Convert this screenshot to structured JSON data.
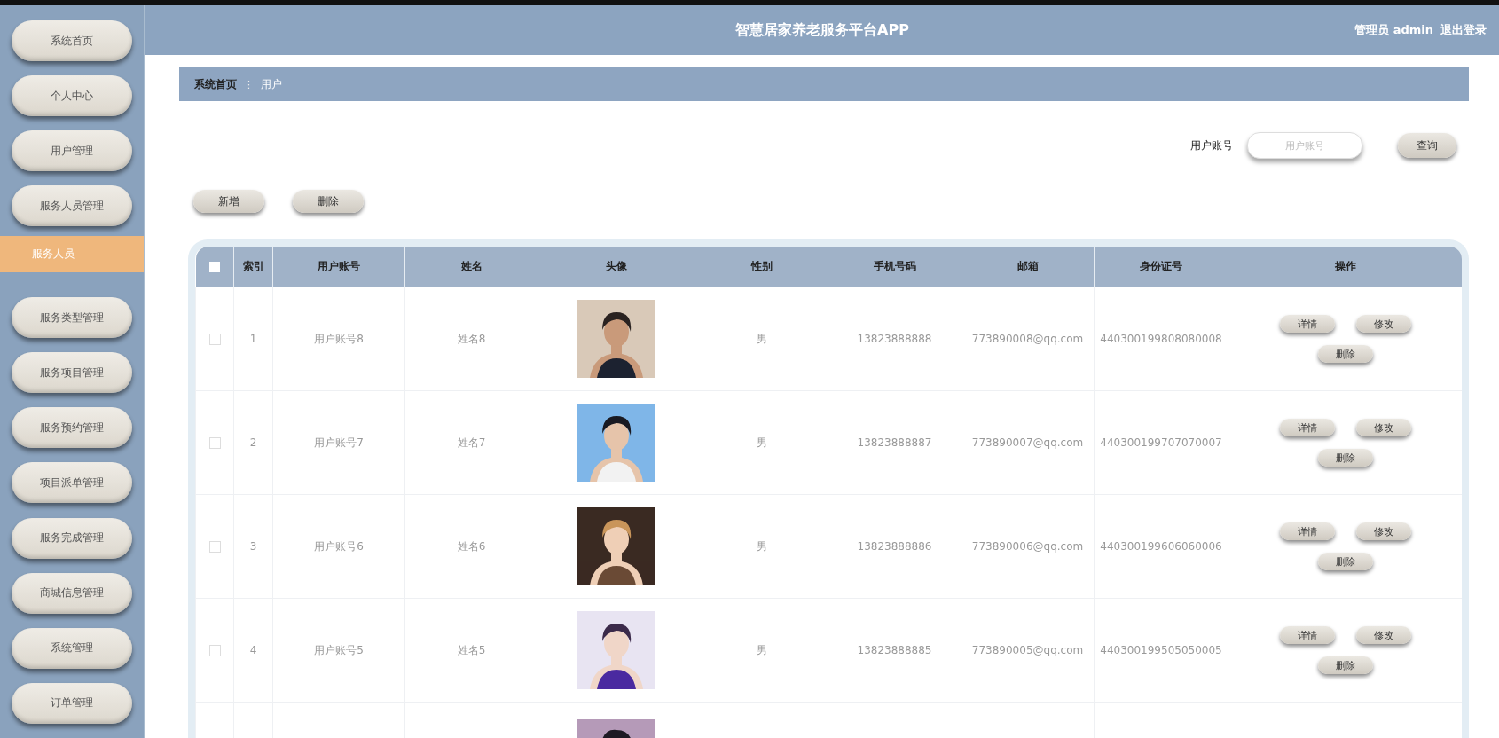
{
  "header": {
    "title": "智慧居家养老服务平台APP",
    "user": "管理员 admin",
    "logout": "退出登录"
  },
  "sidebar": {
    "items": [
      {
        "label": "系统首页",
        "selected": false
      },
      {
        "label": "个人中心",
        "selected": false
      },
      {
        "label": "用户管理",
        "selected": false
      },
      {
        "label": "服务人员管理",
        "selected": false,
        "expanded": true,
        "children": [
          {
            "label": "服务人员",
            "selected": true
          }
        ]
      },
      {
        "label": "服务类型管理",
        "selected": false
      },
      {
        "label": "服务项目管理",
        "selected": false
      },
      {
        "label": "服务预约管理",
        "selected": false
      },
      {
        "label": "项目派单管理",
        "selected": false
      },
      {
        "label": "服务完成管理",
        "selected": false
      },
      {
        "label": "商城信息管理",
        "selected": false
      },
      {
        "label": "系统管理",
        "selected": false
      },
      {
        "label": "订单管理",
        "selected": false
      }
    ]
  },
  "breadcrumb": {
    "items": [
      "系统首页",
      "用户"
    ],
    "separator": "⋮"
  },
  "search": {
    "label": "用户账号",
    "placeholder": "用户账号",
    "button": "查询"
  },
  "actions": [
    "新增",
    "删除"
  ],
  "table": {
    "select_all": {
      "checked": false
    },
    "columns": [
      "索引",
      "用户账号",
      "姓名",
      "头像",
      "性别",
      "手机号码",
      "邮箱",
      "身份证号",
      "操作"
    ],
    "rows": [
      {
        "checked": false,
        "cells": [
          "1",
          "用户账号8",
          "姓名8",
          {
            "kind": "picture"
          },
          "男",
          "13823888888",
          "773890008@qq.com",
          "440300199808080008"
        ],
        "buttons": [
          "详情",
          "修改",
          "删除"
        ]
      },
      {
        "checked": false,
        "cells": [
          "2",
          "用户账号7",
          "姓名7",
          {
            "kind": "picture"
          },
          "男",
          "13823888887",
          "773890007@qq.com",
          "440300199707070007"
        ],
        "buttons": [
          "详情",
          "修改",
          "删除"
        ]
      },
      {
        "checked": false,
        "cells": [
          "3",
          "用户账号6",
          "姓名6",
          {
            "kind": "picture"
          },
          "男",
          "13823888886",
          "773890006@qq.com",
          "440300199606060006"
        ],
        "buttons": [
          "详情",
          "修改",
          "删除"
        ]
      },
      {
        "checked": false,
        "cells": [
          "4",
          "用户账号5",
          "姓名5",
          {
            "kind": "picture"
          },
          "男",
          "13823888885",
          "773890005@qq.com",
          "440300199505050005"
        ],
        "buttons": [
          "详情",
          "修改",
          "删除"
        ]
      }
    ],
    "partial_row": {
      "avatar": {
        "kind": "picture"
      }
    }
  }
}
